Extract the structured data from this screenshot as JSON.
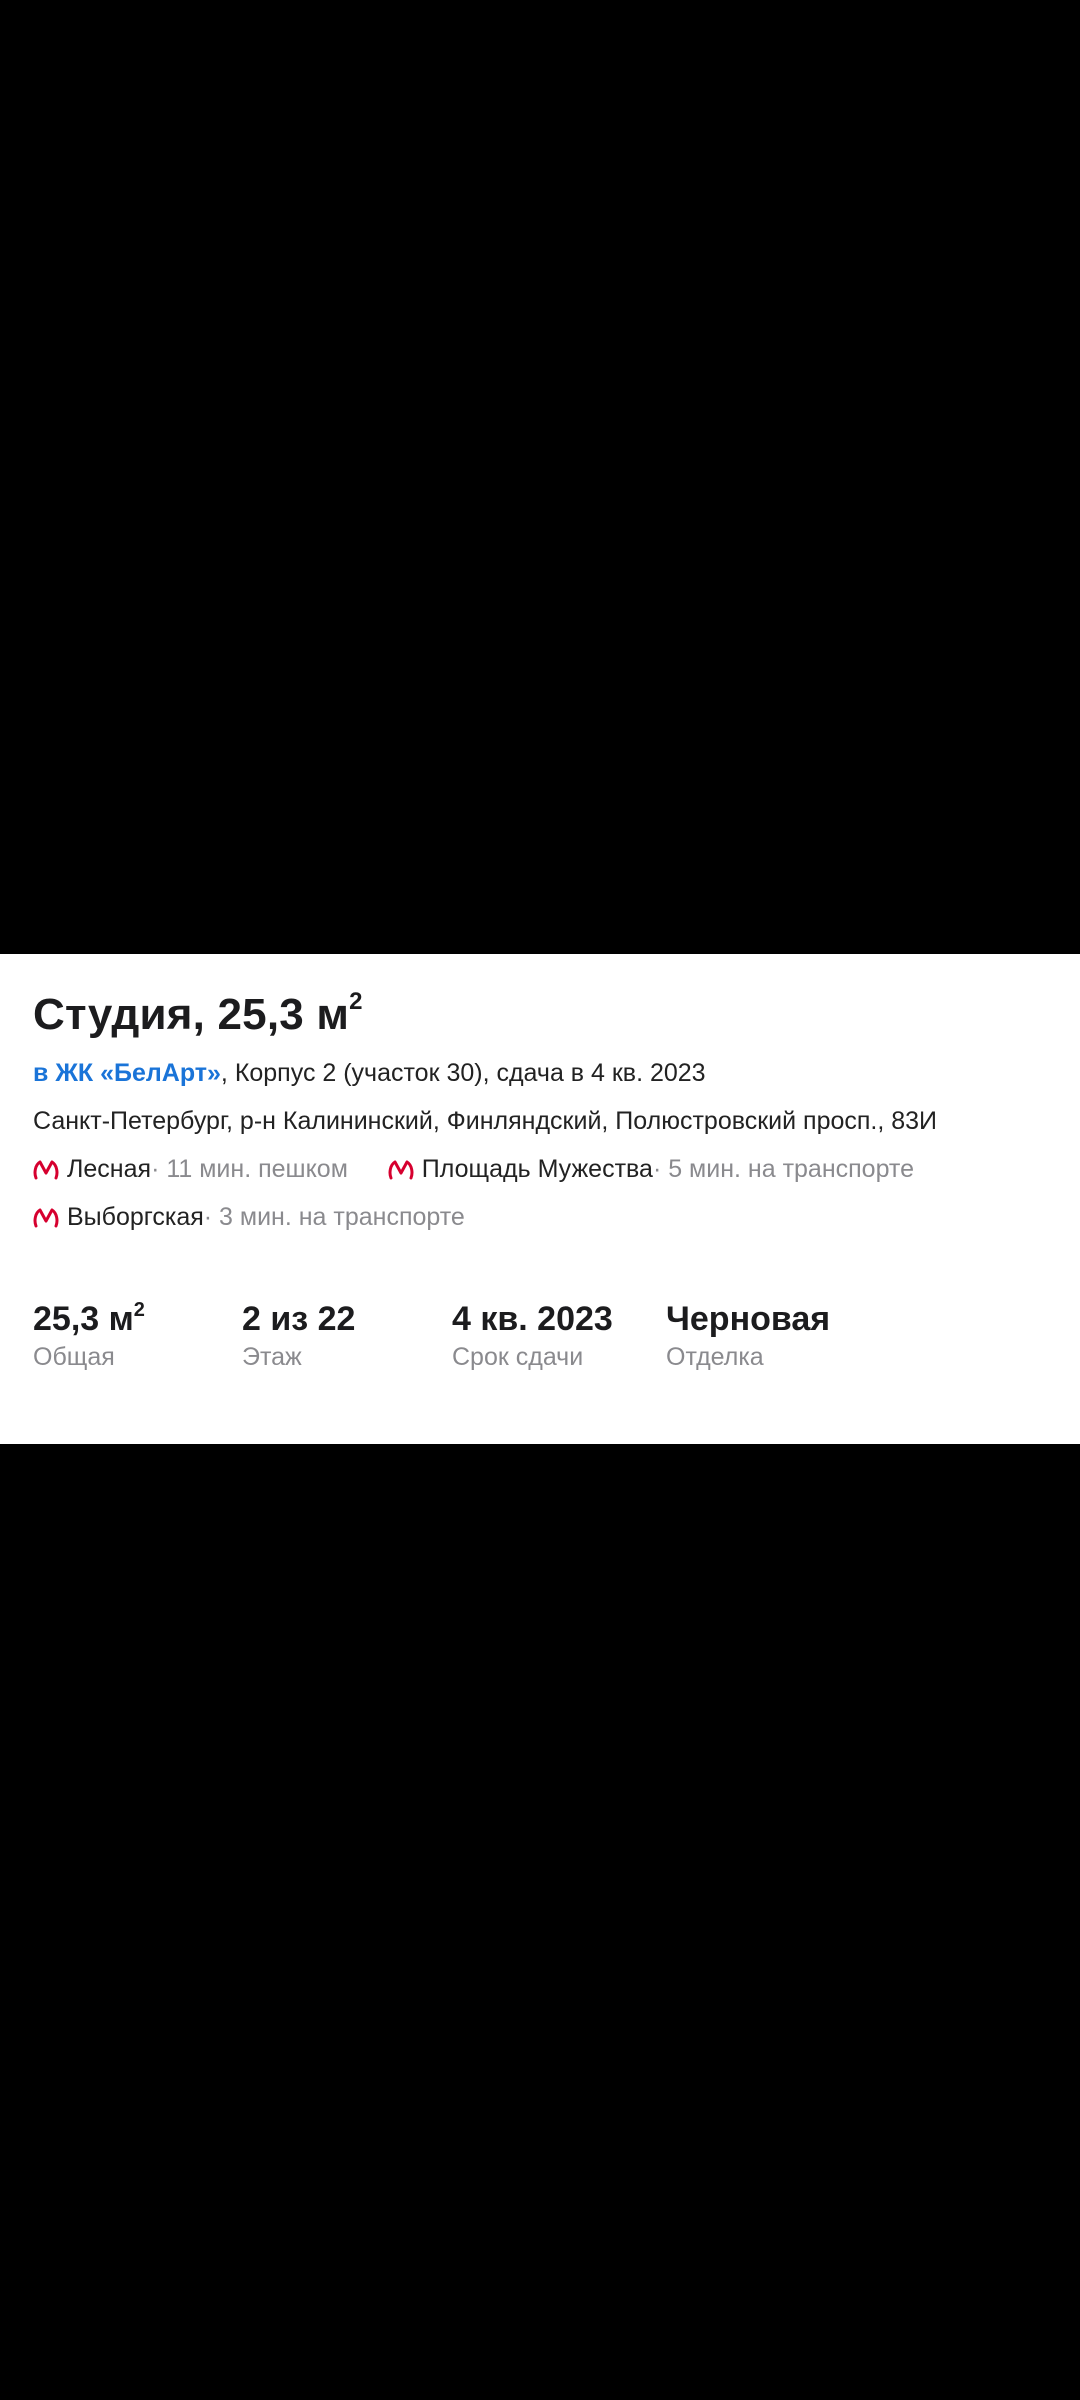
{
  "listing": {
    "title": "Студия, 25,3 м",
    "title_sup": "2",
    "complex_link": "в ЖК «БелАрт»",
    "complex_details": ", Корпус 2 (участок 30), сдача в 4 кв. 2023",
    "address": "Санкт-Петербург, р-н Калининский, Финляндский, Полюстровский просп., 83И"
  },
  "metro": [
    {
      "name": "Лесная",
      "time": " · 11 мин. пешком",
      "icon": "metro-icon",
      "color": "#d6002f"
    },
    {
      "name": "Площадь Мужества",
      "time": " · 5 мин. на транспорте",
      "icon": "metro-icon",
      "color": "#d6002f"
    },
    {
      "name": "Выборгская",
      "time": " · 3 мин. на транспорте",
      "icon": "metro-icon",
      "color": "#d6002f"
    }
  ],
  "stats": [
    {
      "value": "25,3 м",
      "value_sup": "2",
      "label": "Общая"
    },
    {
      "value": "2 из 22",
      "label": "Этаж"
    },
    {
      "value": "4 кв. 2023",
      "label": "Срок сдачи"
    },
    {
      "value": "Черновая",
      "label": "Отделка"
    }
  ],
  "colors": {
    "accent_link": "#1a74d8",
    "metro_red": "#d6002f",
    "text_primary": "#1c1c1e",
    "text_secondary": "#8a8a8e"
  }
}
